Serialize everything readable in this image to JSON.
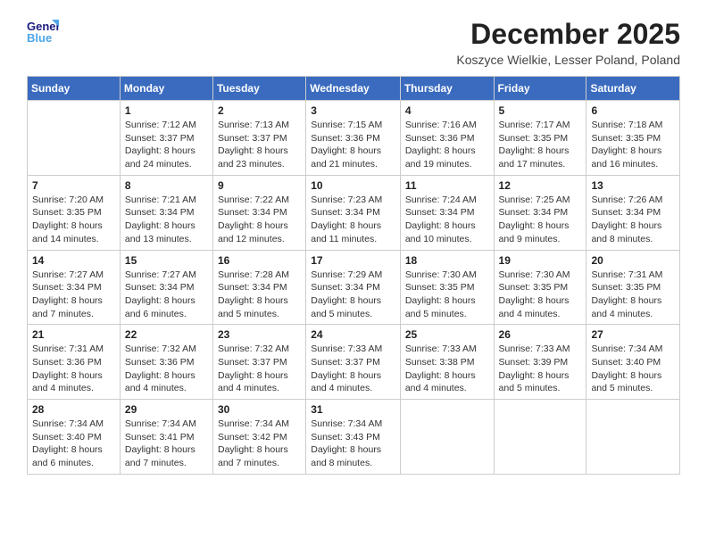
{
  "logo": {
    "line1": "General",
    "line2": "Blue"
  },
  "title": "December 2025",
  "location": "Koszyce Wielkie, Lesser Poland, Poland",
  "weekdays": [
    "Sunday",
    "Monday",
    "Tuesday",
    "Wednesday",
    "Thursday",
    "Friday",
    "Saturday"
  ],
  "weeks": [
    [
      {
        "day": "",
        "sunrise": "",
        "sunset": "",
        "daylight": ""
      },
      {
        "day": "1",
        "sunrise": "7:12 AM",
        "sunset": "3:37 PM",
        "daylight": "8 hours and 24 minutes."
      },
      {
        "day": "2",
        "sunrise": "7:13 AM",
        "sunset": "3:37 PM",
        "daylight": "8 hours and 23 minutes."
      },
      {
        "day": "3",
        "sunrise": "7:15 AM",
        "sunset": "3:36 PM",
        "daylight": "8 hours and 21 minutes."
      },
      {
        "day": "4",
        "sunrise": "7:16 AM",
        "sunset": "3:36 PM",
        "daylight": "8 hours and 19 minutes."
      },
      {
        "day": "5",
        "sunrise": "7:17 AM",
        "sunset": "3:35 PM",
        "daylight": "8 hours and 17 minutes."
      },
      {
        "day": "6",
        "sunrise": "7:18 AM",
        "sunset": "3:35 PM",
        "daylight": "8 hours and 16 minutes."
      }
    ],
    [
      {
        "day": "7",
        "sunrise": "7:20 AM",
        "sunset": "3:35 PM",
        "daylight": "8 hours and 14 minutes."
      },
      {
        "day": "8",
        "sunrise": "7:21 AM",
        "sunset": "3:34 PM",
        "daylight": "8 hours and 13 minutes."
      },
      {
        "day": "9",
        "sunrise": "7:22 AM",
        "sunset": "3:34 PM",
        "daylight": "8 hours and 12 minutes."
      },
      {
        "day": "10",
        "sunrise": "7:23 AM",
        "sunset": "3:34 PM",
        "daylight": "8 hours and 11 minutes."
      },
      {
        "day": "11",
        "sunrise": "7:24 AM",
        "sunset": "3:34 PM",
        "daylight": "8 hours and 10 minutes."
      },
      {
        "day": "12",
        "sunrise": "7:25 AM",
        "sunset": "3:34 PM",
        "daylight": "8 hours and 9 minutes."
      },
      {
        "day": "13",
        "sunrise": "7:26 AM",
        "sunset": "3:34 PM",
        "daylight": "8 hours and 8 minutes."
      }
    ],
    [
      {
        "day": "14",
        "sunrise": "7:27 AM",
        "sunset": "3:34 PM",
        "daylight": "8 hours and 7 minutes."
      },
      {
        "day": "15",
        "sunrise": "7:27 AM",
        "sunset": "3:34 PM",
        "daylight": "8 hours and 6 minutes."
      },
      {
        "day": "16",
        "sunrise": "7:28 AM",
        "sunset": "3:34 PM",
        "daylight": "8 hours and 5 minutes."
      },
      {
        "day": "17",
        "sunrise": "7:29 AM",
        "sunset": "3:34 PM",
        "daylight": "8 hours and 5 minutes."
      },
      {
        "day": "18",
        "sunrise": "7:30 AM",
        "sunset": "3:35 PM",
        "daylight": "8 hours and 5 minutes."
      },
      {
        "day": "19",
        "sunrise": "7:30 AM",
        "sunset": "3:35 PM",
        "daylight": "8 hours and 4 minutes."
      },
      {
        "day": "20",
        "sunrise": "7:31 AM",
        "sunset": "3:35 PM",
        "daylight": "8 hours and 4 minutes."
      }
    ],
    [
      {
        "day": "21",
        "sunrise": "7:31 AM",
        "sunset": "3:36 PM",
        "daylight": "8 hours and 4 minutes."
      },
      {
        "day": "22",
        "sunrise": "7:32 AM",
        "sunset": "3:36 PM",
        "daylight": "8 hours and 4 minutes."
      },
      {
        "day": "23",
        "sunrise": "7:32 AM",
        "sunset": "3:37 PM",
        "daylight": "8 hours and 4 minutes."
      },
      {
        "day": "24",
        "sunrise": "7:33 AM",
        "sunset": "3:37 PM",
        "daylight": "8 hours and 4 minutes."
      },
      {
        "day": "25",
        "sunrise": "7:33 AM",
        "sunset": "3:38 PM",
        "daylight": "8 hours and 4 minutes."
      },
      {
        "day": "26",
        "sunrise": "7:33 AM",
        "sunset": "3:39 PM",
        "daylight": "8 hours and 5 minutes."
      },
      {
        "day": "27",
        "sunrise": "7:34 AM",
        "sunset": "3:40 PM",
        "daylight": "8 hours and 5 minutes."
      }
    ],
    [
      {
        "day": "28",
        "sunrise": "7:34 AM",
        "sunset": "3:40 PM",
        "daylight": "8 hours and 6 minutes."
      },
      {
        "day": "29",
        "sunrise": "7:34 AM",
        "sunset": "3:41 PM",
        "daylight": "8 hours and 7 minutes."
      },
      {
        "day": "30",
        "sunrise": "7:34 AM",
        "sunset": "3:42 PM",
        "daylight": "8 hours and 7 minutes."
      },
      {
        "day": "31",
        "sunrise": "7:34 AM",
        "sunset": "3:43 PM",
        "daylight": "8 hours and 8 minutes."
      },
      {
        "day": "",
        "sunrise": "",
        "sunset": "",
        "daylight": ""
      },
      {
        "day": "",
        "sunrise": "",
        "sunset": "",
        "daylight": ""
      },
      {
        "day": "",
        "sunrise": "",
        "sunset": "",
        "daylight": ""
      }
    ]
  ]
}
